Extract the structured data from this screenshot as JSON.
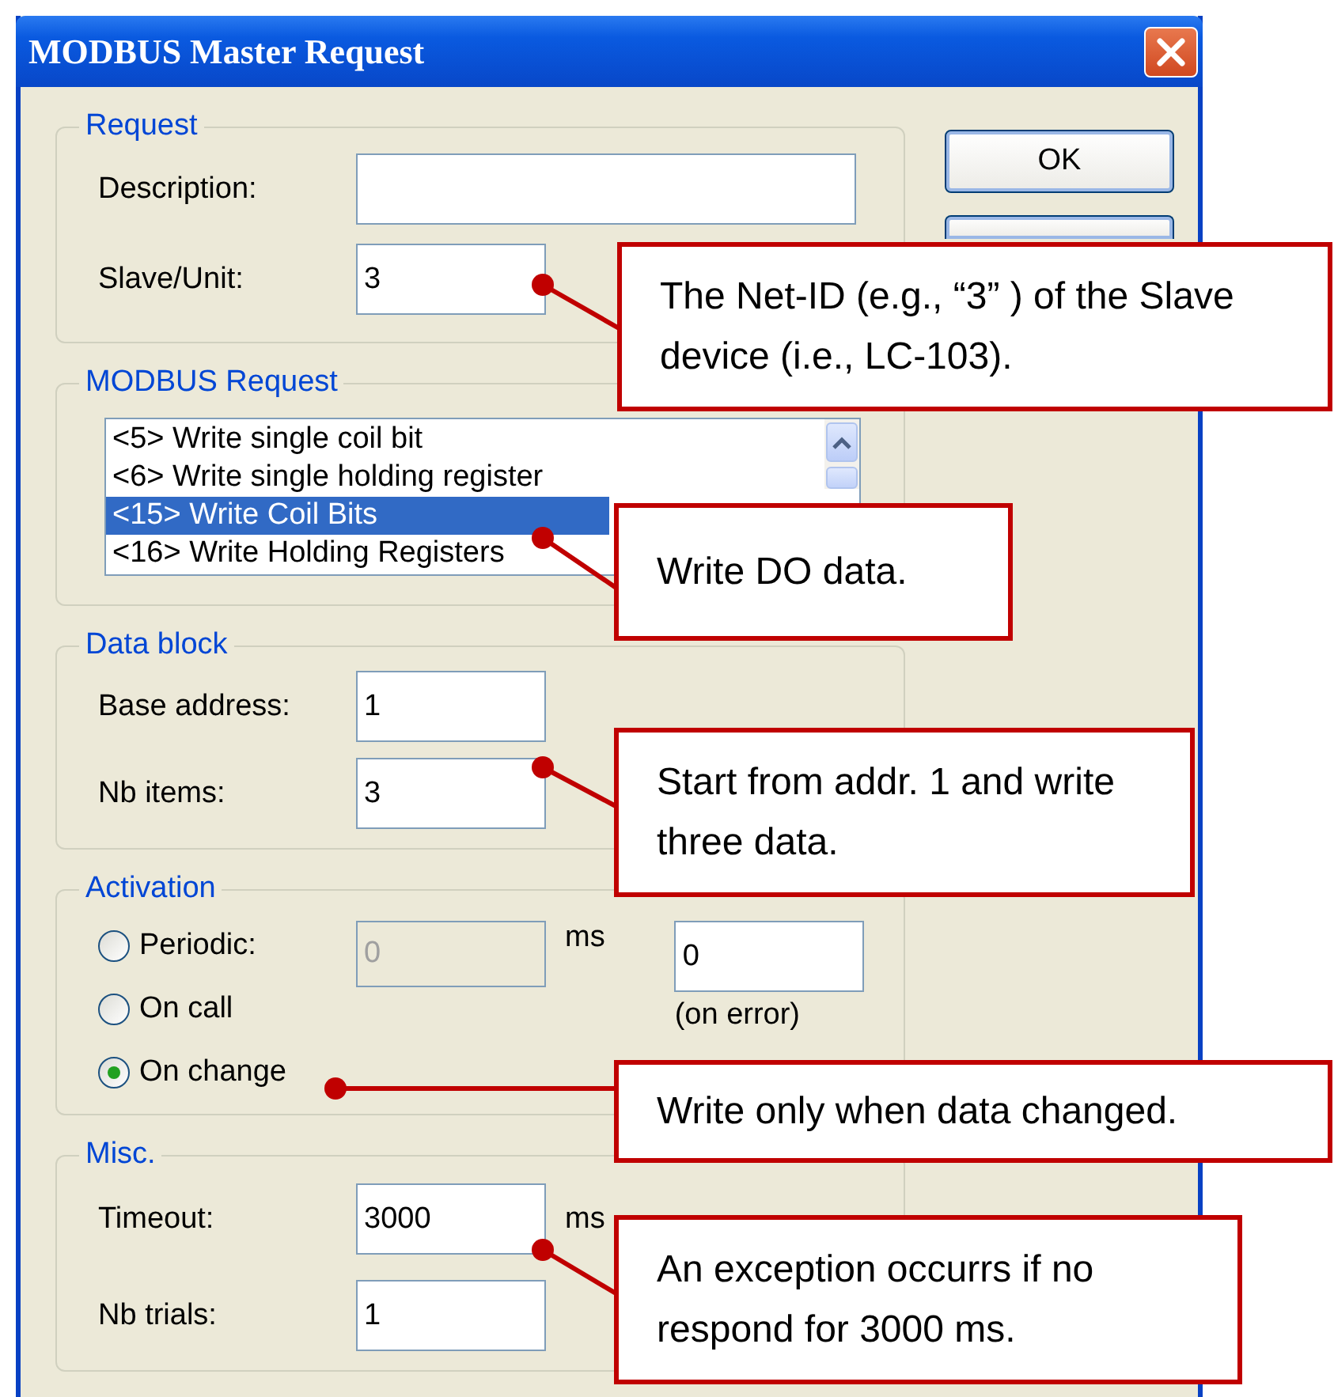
{
  "window": {
    "title": "MODBUS Master Request"
  },
  "buttons": [
    {
      "label": "OK"
    }
  ],
  "request": {
    "title": "Request",
    "fields": [
      {
        "label": "Description:"
      },
      {
        "label": "Slave/Unit:",
        "value": "3"
      }
    ]
  },
  "modbus_request": {
    "title": "MODBUS Request",
    "items": [
      {
        "label": "<5> Write single coil bit",
        "selected": false
      },
      {
        "label": "<6> Write single holding register",
        "selected": false
      },
      {
        "label": "<15> Write Coil Bits",
        "selected": true
      },
      {
        "label": "<16> Write Holding Registers",
        "selected": false
      }
    ]
  },
  "data_block": {
    "title": "Data block",
    "fields": [
      {
        "label": "Base address:",
        "value": "1"
      },
      {
        "label": "Nb items:",
        "value": "3"
      }
    ]
  },
  "activation": {
    "title": "Activation",
    "options": [
      {
        "label": "Periodic:",
        "selected": false
      },
      {
        "label": "On call",
        "selected": false
      },
      {
        "label": "On change",
        "selected": true
      }
    ],
    "period": {
      "value": "0",
      "disabled": true,
      "unit": "ms"
    },
    "error_value": "0",
    "error_label": "(on error)"
  },
  "misc": {
    "title": "Misc.",
    "fields": [
      {
        "label": "Timeout:",
        "value": "3000",
        "unit": "ms"
      },
      {
        "label": "Nb trials:",
        "value": "1"
      }
    ]
  },
  "callouts": [
    {
      "text": "The Net-ID (e.g., “3” ) of the Slave device (i.e., LC-103)."
    },
    {
      "text": "Write DO data."
    },
    {
      "text": "Start from addr. 1 and write three data."
    },
    {
      "text": "Write only when data changed."
    },
    {
      "text": "An exception occurrs if no respond for 3000 ms."
    }
  ]
}
